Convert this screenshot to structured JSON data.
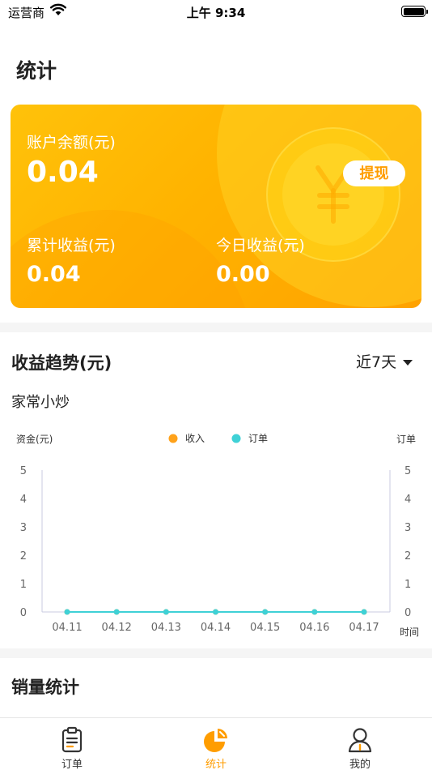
{
  "status_bar": {
    "carrier": "运营商",
    "time": "上午 9:34"
  },
  "page_title": "统计",
  "card": {
    "balance_label": "账户余额(元)",
    "balance_value": "0.04",
    "withdraw_label": "提现",
    "total_label": "累计收益(元)",
    "total_value": "0.04",
    "today_label": "今日收益(元)",
    "today_value": "0.00"
  },
  "trend": {
    "title": "收益趋势(元)",
    "range": "近7天",
    "shop_name": "家常小炒"
  },
  "sales": {
    "title": "销量统计"
  },
  "tabs": [
    {
      "label": "订单",
      "icon": "clipboard-icon",
      "active": false
    },
    {
      "label": "统计",
      "icon": "pie-chart-icon",
      "active": true
    },
    {
      "label": "我的",
      "icon": "user-icon",
      "active": false
    }
  ],
  "colors": {
    "accent": "#ff9d00",
    "income": "#ffa21a",
    "orders": "#3fd1d6"
  },
  "chart_data": {
    "type": "line",
    "categories": [
      "04.11",
      "04.12",
      "04.13",
      "04.14",
      "04.15",
      "04.16",
      "04.17"
    ],
    "series": [
      {
        "name": "收入",
        "values": [
          0,
          0,
          0,
          0,
          0,
          0,
          0
        ],
        "axis": "left"
      },
      {
        "name": "订单",
        "values": [
          0,
          0,
          0,
          0,
          0,
          0,
          0
        ],
        "axis": "right"
      }
    ],
    "ylabel_left": "资金(元)",
    "ylabel_right": "订单",
    "xlabel": "时间",
    "ylim": [
      0,
      5
    ],
    "yticks": [
      0,
      1,
      2,
      3,
      4,
      5
    ],
    "legend": "top-center",
    "grid": false
  }
}
